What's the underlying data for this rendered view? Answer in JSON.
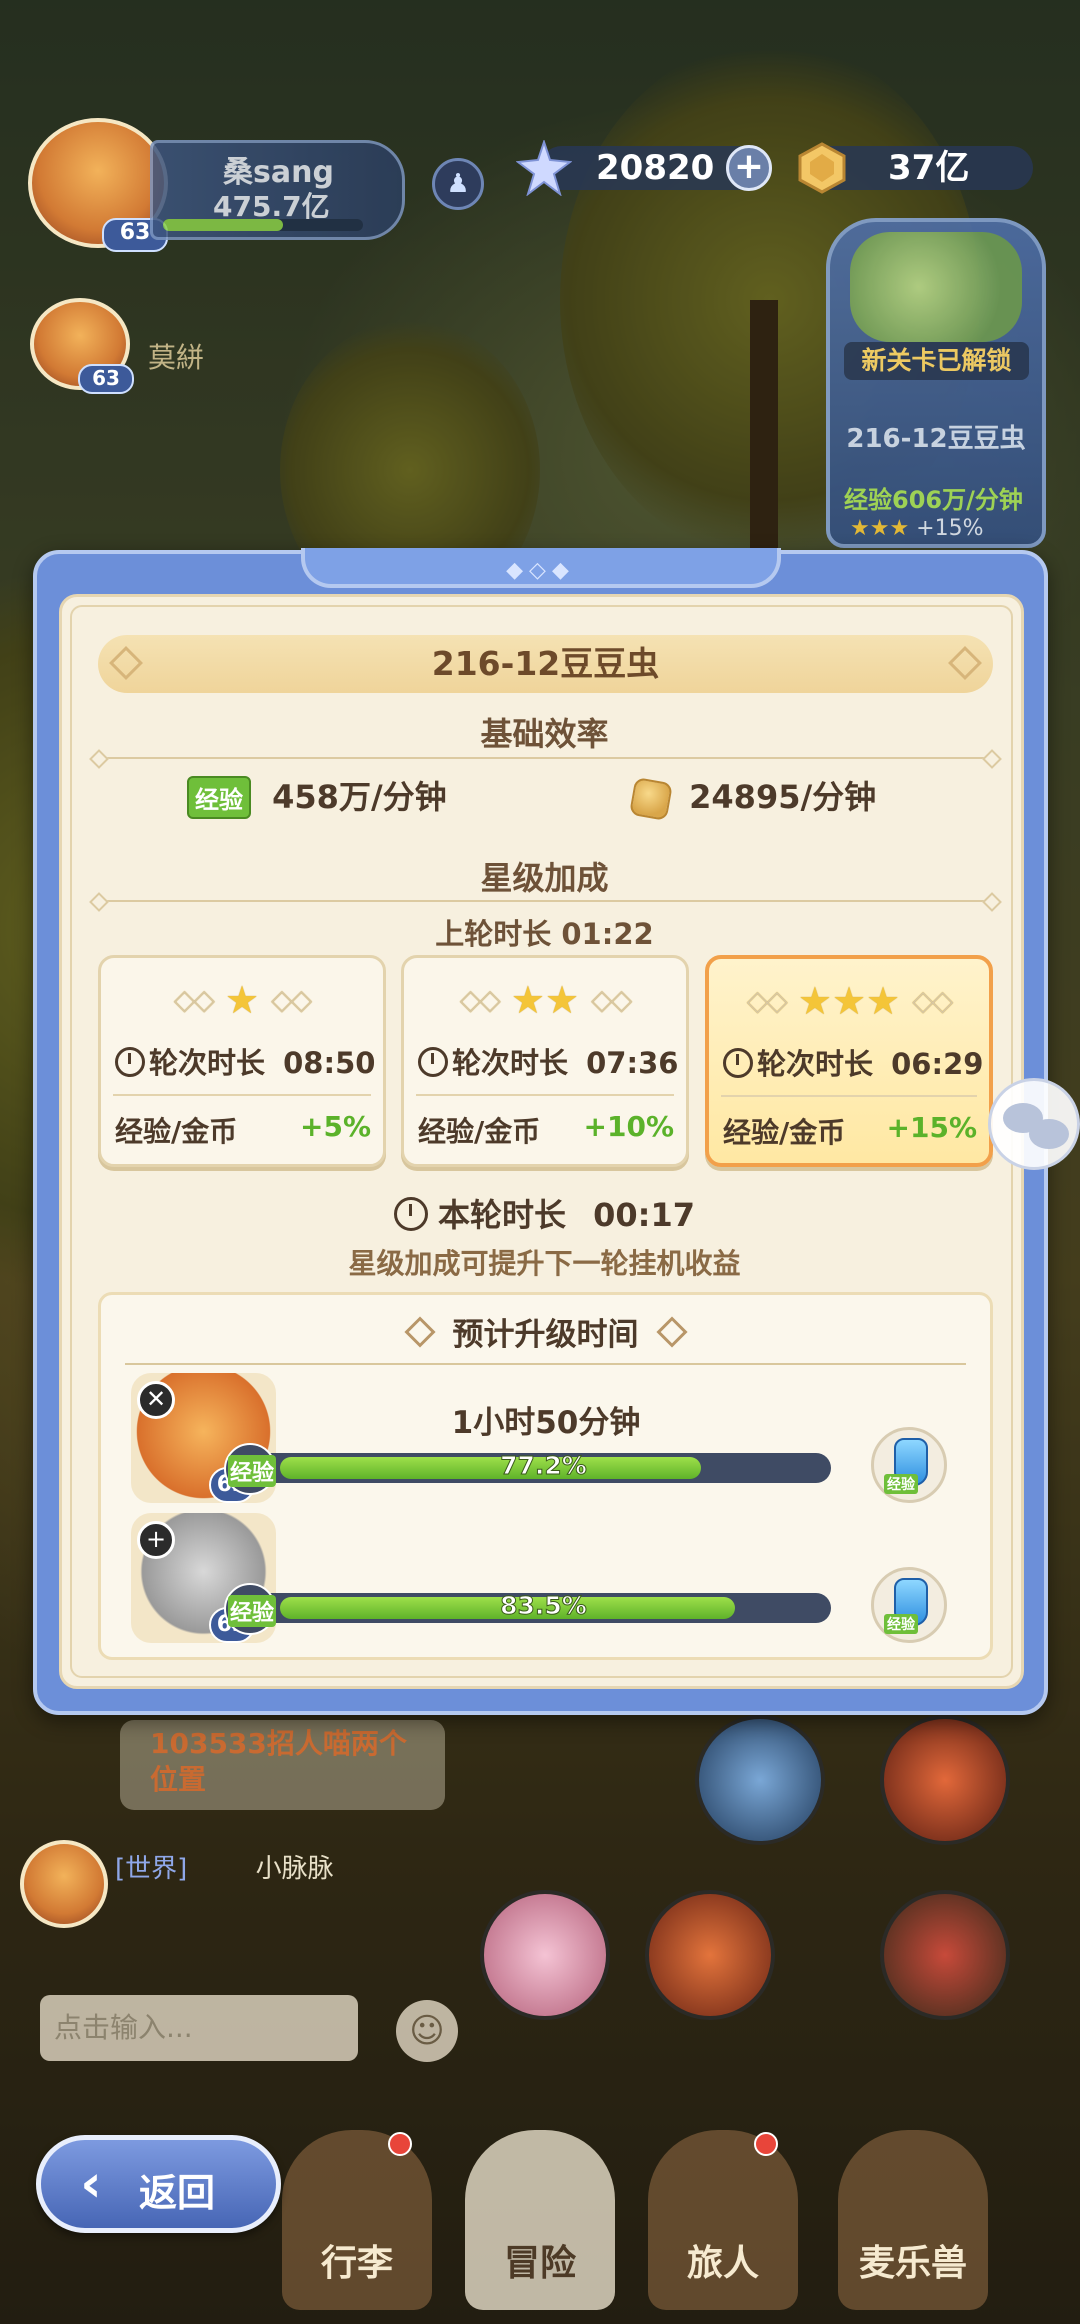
{
  "hud": {
    "player_name": "桑sang",
    "power": "475.7亿",
    "player_level": "63",
    "friend_name": "莫絣",
    "friend_level": "63",
    "gems": "20820",
    "gold": "37亿",
    "gem_icon": "crystal-star-icon",
    "gold_icon": "gold-coin-icon"
  },
  "stage_widget": {
    "unlocked": "新关卡已解锁",
    "stage_name": "216-12豆豆虫",
    "exp_rate": "经验606万/分钟",
    "stars": "★★★",
    "bonus": "+15%"
  },
  "modal": {
    "stage_title": "216-12豆豆虫",
    "base_efficiency_title": "基础效率",
    "exp_label": "经验",
    "exp_rate": "458万/分钟",
    "gold_rate": "24895/分钟",
    "star_bonus_title": "星级加成",
    "last_round_duration": "上轮时长 01:22",
    "tiers": [
      {
        "stars": "★",
        "duration_label": "轮次时长",
        "duration": "08:50",
        "bonus_label": "经验/金币",
        "bonus": "+5%"
      },
      {
        "stars": "★★",
        "duration_label": "轮次时长",
        "duration": "07:36",
        "bonus_label": "经验/金币",
        "bonus": "+10%"
      },
      {
        "stars": "★★★",
        "duration_label": "轮次时长",
        "duration": "06:29",
        "bonus_label": "经验/金币",
        "bonus": "+15%"
      }
    ],
    "current_round_label": "本轮时长",
    "current_round_duration": "00:17",
    "hint": "星级加成可提升下一轮挂机收益",
    "upgrade_title": "预计升级时间",
    "heroes": [
      {
        "level": "63",
        "eta": "1小时50分钟",
        "exp_label": "经验",
        "progress_text": "77.2%",
        "progress": 0.772,
        "potion_tag": "经验"
      },
      {
        "level": "63",
        "eta": "",
        "exp_label": "经验",
        "progress_text": "83.5%",
        "progress": 0.835,
        "potion_tag": "经验"
      }
    ]
  },
  "chat": {
    "recruit_message": "103533招人喵两个位置",
    "world_tag": "[世界]",
    "world_user": "小脉脉",
    "input_placeholder": "点击输入..."
  },
  "nav": {
    "items": [
      "行李",
      "冒险",
      "旅人",
      "麦乐兽"
    ],
    "back_label": "返回"
  },
  "colors": {
    "modal_frame": "#6c8fd9",
    "panel_bg": "#f7f0df",
    "bonus_green": "#5bb22a",
    "active_tier_border": "#f2a04a"
  }
}
